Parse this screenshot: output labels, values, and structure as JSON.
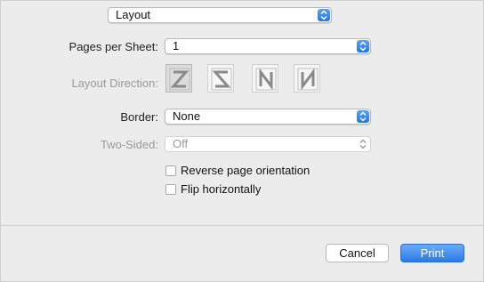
{
  "section_popup": {
    "value": "Layout"
  },
  "pages_per_sheet": {
    "label": "Pages per Sheet:",
    "value": "1"
  },
  "layout_direction": {
    "label": "Layout Direction:",
    "options": [
      "z-left-to-right",
      "z-right-to-left",
      "n-top-to-bottom",
      "n-top-to-bottom-reversed"
    ]
  },
  "border": {
    "label": "Border:",
    "value": "None"
  },
  "two_sided": {
    "label": "Two-Sided:",
    "value": "Off"
  },
  "reverse_orientation": {
    "label": "Reverse page orientation",
    "checked": false
  },
  "flip_horizontally": {
    "label": "Flip horizontally",
    "checked": false
  },
  "buttons": {
    "cancel": "Cancel",
    "print": "Print"
  },
  "colors": {
    "accent": "#2c7ae9",
    "background": "#ececec"
  }
}
